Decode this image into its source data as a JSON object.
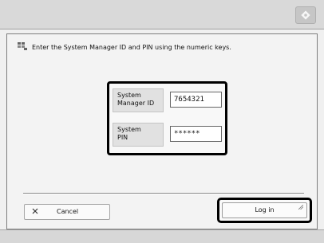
{
  "topbar": {
    "corner_icon": "settings-icon"
  },
  "instruction": {
    "icon": "keys-icon",
    "text": "Enter the System Manager ID and PIN using the numeric keys."
  },
  "auth": {
    "id_label": "System\nManager ID",
    "id_value": "7654321",
    "pin_label": "System\nPIN",
    "pin_value": "******"
  },
  "actions": {
    "cancel_icon": "close-icon",
    "cancel_label": "Cancel",
    "login_label": "Log in",
    "login_corner_icon": "resize-corner-icon"
  },
  "colors": {
    "panel_border": "#7d7d7d",
    "highlight_border": "#000000"
  }
}
